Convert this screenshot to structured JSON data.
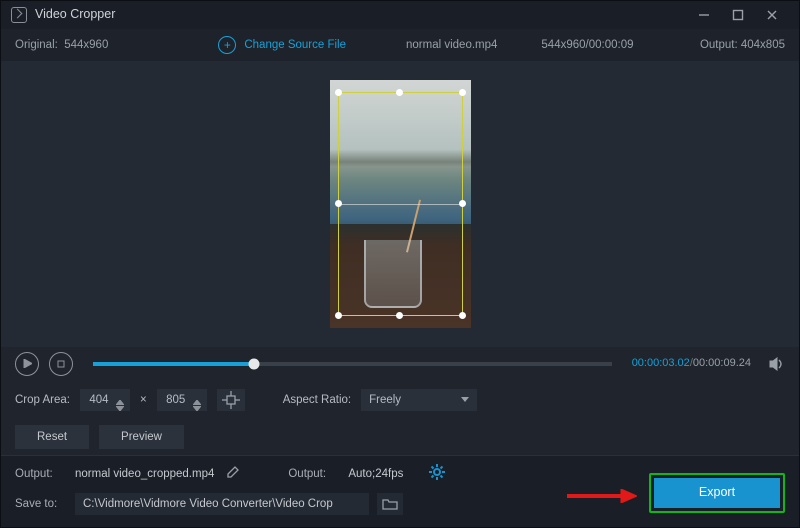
{
  "titlebar": {
    "app_title": "Video Cropper"
  },
  "infostrip": {
    "original_label": "Original:  544x960",
    "change_label": "Change Source File",
    "filename": "normal video.mp4",
    "source_meta": "544x960/00:00:09",
    "output_label": "Output: 404x805"
  },
  "playbar": {
    "current": "00:00:03.02",
    "total": "00:00:09.24"
  },
  "controls": {
    "crop_area_label": "Crop Area:",
    "width": "404",
    "height": "805",
    "aspect_label": "Aspect Ratio:",
    "aspect_value": "Freely"
  },
  "row2": {
    "reset": "Reset",
    "preview": "Preview"
  },
  "output": {
    "out_label": "Output:",
    "out_file": "normal video_cropped.mp4",
    "fmt_label": "Output:",
    "fmt_value": "Auto;24fps",
    "save_label": "Save to:",
    "save_path": "C:\\Vidmore\\Vidmore Video Converter\\Video Crop",
    "export": "Export"
  }
}
